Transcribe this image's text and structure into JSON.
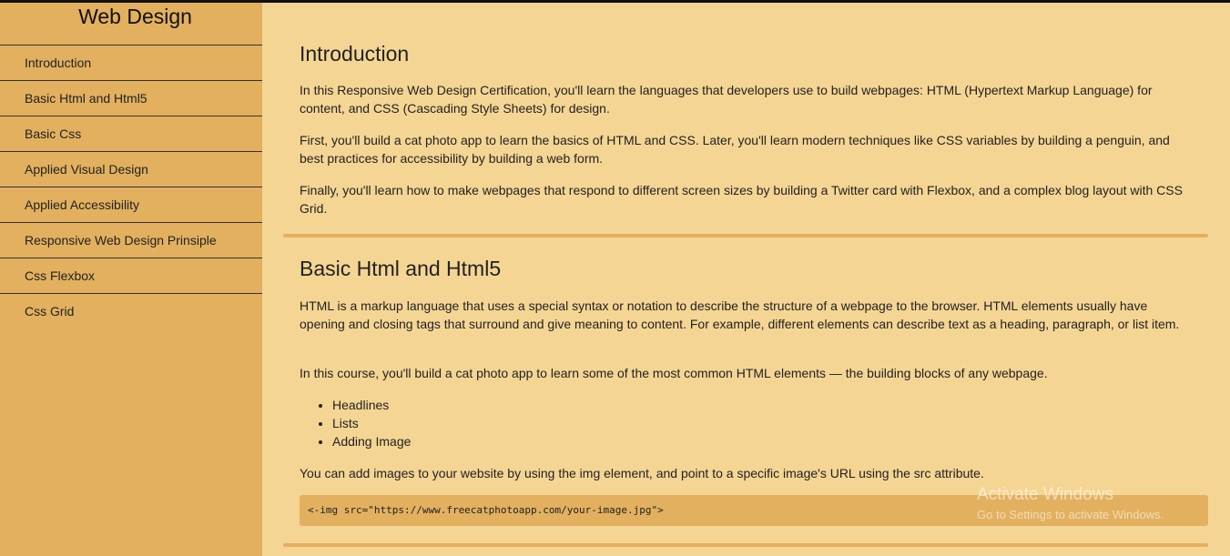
{
  "sidebar": {
    "title": "Web Design",
    "items": [
      {
        "label": "Introduction"
      },
      {
        "label": "Basic Html and Html5"
      },
      {
        "label": "Basic Css"
      },
      {
        "label": "Applied Visual Design"
      },
      {
        "label": "Applied Accessibility"
      },
      {
        "label": "Responsive Web Design Prinsiple"
      },
      {
        "label": "Css Flexbox"
      },
      {
        "label": "Css Grid"
      }
    ]
  },
  "main": {
    "sections": [
      {
        "heading": "Introduction",
        "paragraphs": [
          "In this Responsive Web Design Certification, you'll learn the languages that developers use to build webpages: HTML (Hypertext Markup Language) for content, and CSS (Cascading Style Sheets) for design.",
          "First, you'll build a cat photo app to learn the basics of HTML and CSS. Later, you'll learn modern techniques like CSS variables by building a penguin, and best practices for accessibility by building a web form.",
          "Finally, you'll learn how to make webpages that respond to different screen sizes by building a Twitter card with Flexbox, and a complex blog layout with CSS Grid."
        ]
      },
      {
        "heading": "Basic Html and Html5",
        "paragraphs": [
          "HTML is a markup language that uses a special syntax or notation to describe the structure of a webpage to the browser. HTML elements usually have opening and closing tags that surround and give meaning to content. For example, different elements can describe text as a heading, paragraph, or list item.",
          "In this course, you'll build a cat photo app to learn some of the most common HTML elements — the building blocks of any webpage."
        ],
        "list": [
          "Headlines",
          "Lists",
          "Adding Image"
        ],
        "after_list": "You can add images to your website by using the img element, and point to a specific image's URL using the src attribute.",
        "code": "<-img src=\"https://www.freecatphotoapp.com/your-image.jpg\">"
      }
    ]
  },
  "watermark": {
    "title": "Activate Windows",
    "subtitle": "Go to Settings to activate Windows."
  },
  "colors": {
    "sidebar_bg": "#e2b05f",
    "main_bg": "#f5d594",
    "accent": "#e2b05f"
  }
}
